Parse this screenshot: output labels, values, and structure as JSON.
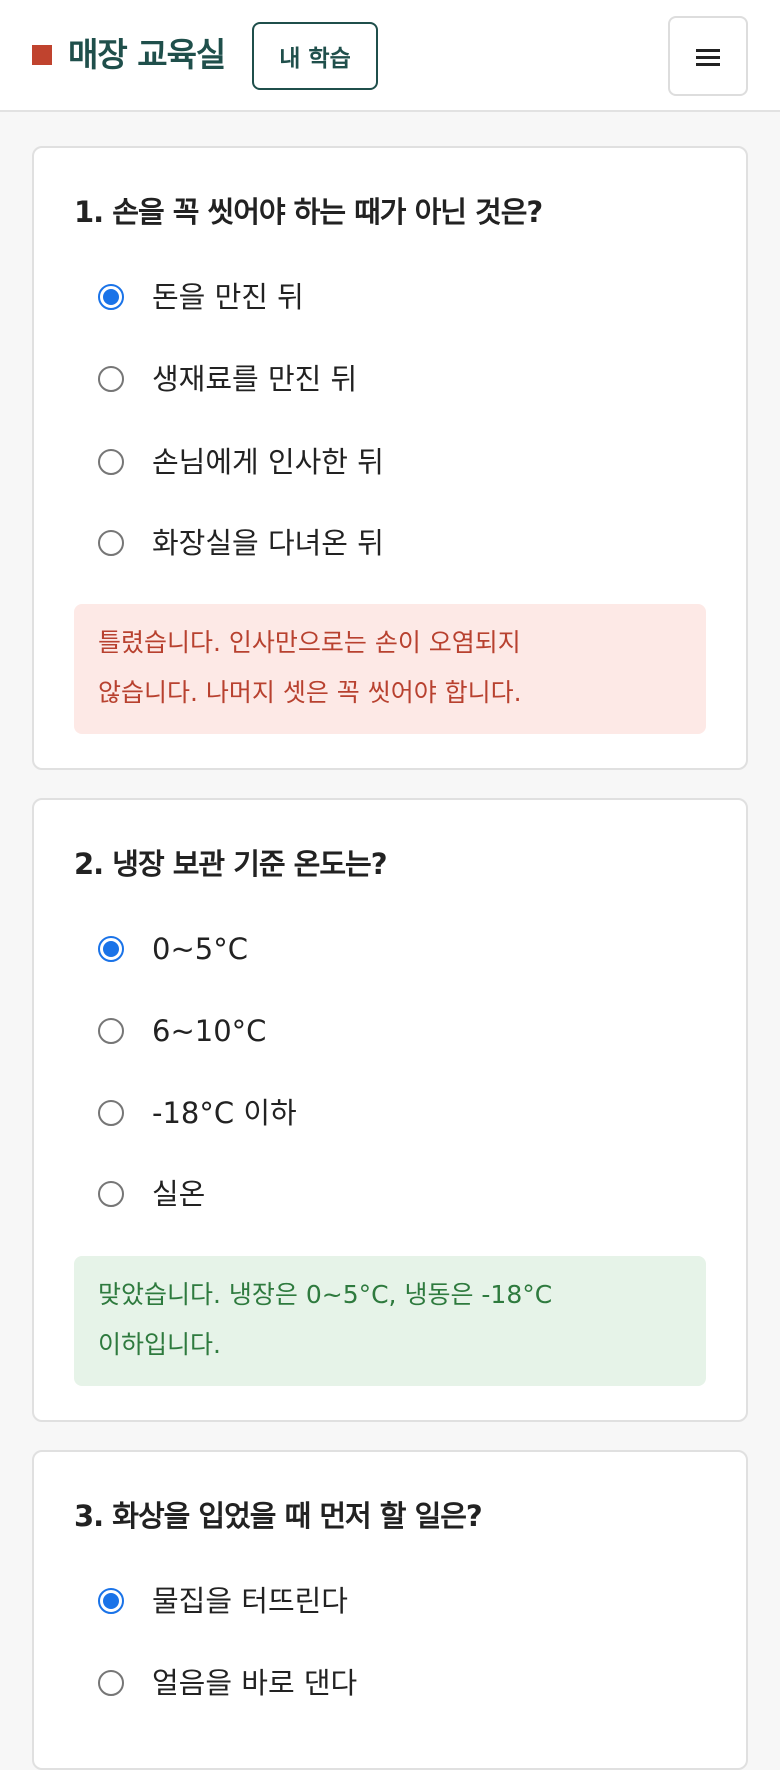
{
  "header": {
    "brand_title": "매장 교육실",
    "my_learning_label": "내 학습",
    "menu_icon": "hamburger-menu-icon",
    "brand_mark_icon": "square-logo-icon"
  },
  "colors": {
    "brand_mark": "#c0432e",
    "brand_text": "#1f4f4b",
    "radio_checked": "#1a73e8",
    "feedback_wrong_bg": "#fde9e6",
    "feedback_wrong_text": "#b8412f",
    "feedback_right_bg": "#e6f3e8",
    "feedback_right_text": "#2e7a3e"
  },
  "quiz": {
    "questions": [
      {
        "title": "1. 손을 꼭 씻어야 하는 때가 아닌 것은?",
        "options": [
          "돈을 만진 뒤",
          "생재료를 만진 뒤",
          "손님에게 인사한 뒤",
          "화장실을 다녀온 뒤"
        ],
        "selected_index": 0,
        "feedback": {
          "status": "wrong",
          "line1": "틀렸습니다. 인사만으로는 손이 오염되지",
          "line2": "않습니다. 나머지 셋은 꼭 씻어야 합니다."
        }
      },
      {
        "title": "2. 냉장 보관 기준 온도는?",
        "options": [
          "0~5°C",
          "6~10°C",
          "-18°C 이하",
          "실온"
        ],
        "selected_index": 0,
        "feedback": {
          "status": "correct",
          "line1": "맞았습니다. 냉장은 0~5°C, 냉동은 -18°C",
          "line2": "이하입니다."
        }
      },
      {
        "title": "3. 화상을 입었을 때 먼저 할 일은?",
        "options": [
          "물집을 터뜨린다",
          "얼음을 바로 댄다"
        ],
        "selected_index": 0
      }
    ]
  }
}
